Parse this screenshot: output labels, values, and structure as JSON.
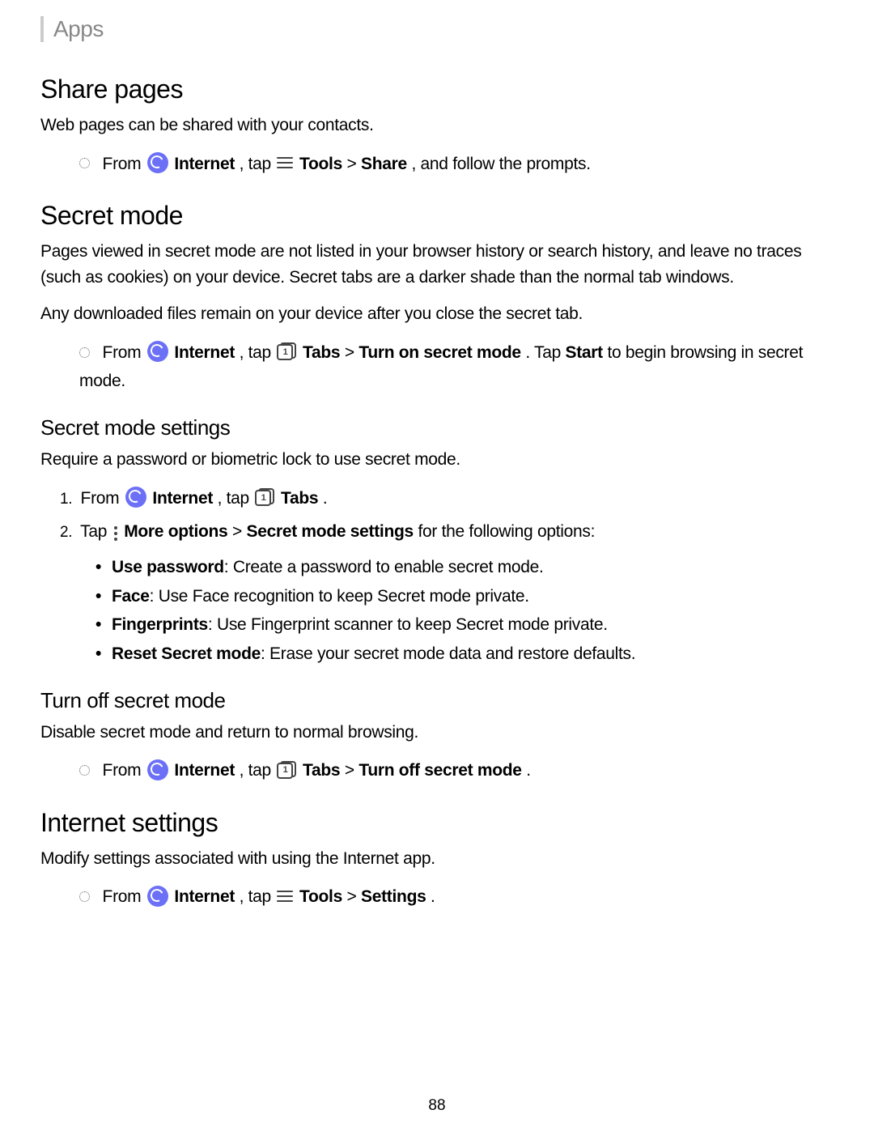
{
  "header": {
    "title": "Apps"
  },
  "sections": {
    "share": {
      "title": "Share pages",
      "intro": "Web pages can be shared with your contacts.",
      "step_from": "From ",
      "step_app": "Internet",
      "step_tap": ", tap ",
      "step_tools": "Tools",
      "step_gt": " > ",
      "step_share": "Share",
      "step_follow": ", and follow the prompts."
    },
    "secret": {
      "title": "Secret mode",
      "intro": "Pages viewed in secret mode are not listed in your browser history or search history, and leave no traces (such as cookies) on your device. Secret tabs are a darker shade than the normal tab windows.",
      "note": "Any downloaded files remain on your device after you close the secret tab.",
      "step_from": "From ",
      "step_app": "Internet",
      "step_tap": ", tap ",
      "step_tabs": "Tabs",
      "step_gt": " > ",
      "step_turnon": "Turn on secret mode",
      "step_tapstart": ". Tap ",
      "step_start": "Start",
      "step_tobegin": " to begin browsing in secret mode."
    },
    "settings": {
      "title": "Secret mode settings",
      "intro": "Require a password or biometric lock to use secret mode.",
      "step1_from": "From ",
      "step1_app": "Internet",
      "step1_tap": ", tap ",
      "step1_tabs": "Tabs",
      "step1_period": ".",
      "step2_tap": "Tap ",
      "step2_more": "More options",
      "step2_gt": " > ",
      "step2_sms": "Secret mode settings",
      "step2_for": " for the following options:",
      "opts": {
        "pw_label": "Use password",
        "pw_desc": ": Create a password to enable secret mode.",
        "face_label": "Face",
        "face_desc": ": Use Face recognition to keep Secret mode private.",
        "fp_label": "Fingerprints",
        "fp_desc": ": Use Fingerprint scanner to keep Secret mode private.",
        "reset_label": "Reset Secret mode",
        "reset_desc": ": Erase your secret mode data and restore defaults."
      }
    },
    "turnoff": {
      "title": "Turn off secret mode",
      "intro": "Disable secret mode and return to normal browsing.",
      "step_from": "From ",
      "step_app": "Internet",
      "step_tap": ", tap ",
      "step_tabs": "Tabs",
      "step_gt": " > ",
      "step_off": "Turn off secret mode",
      "step_period": "."
    },
    "isettings": {
      "title": "Internet settings",
      "intro": "Modify settings associated with using the Internet app.",
      "step_from": "From ",
      "step_app": "Internet",
      "step_tap": ", tap ",
      "step_tools": "Tools",
      "step_gt": " > ",
      "step_set": "Settings",
      "step_period": "."
    }
  },
  "page_number": "88"
}
